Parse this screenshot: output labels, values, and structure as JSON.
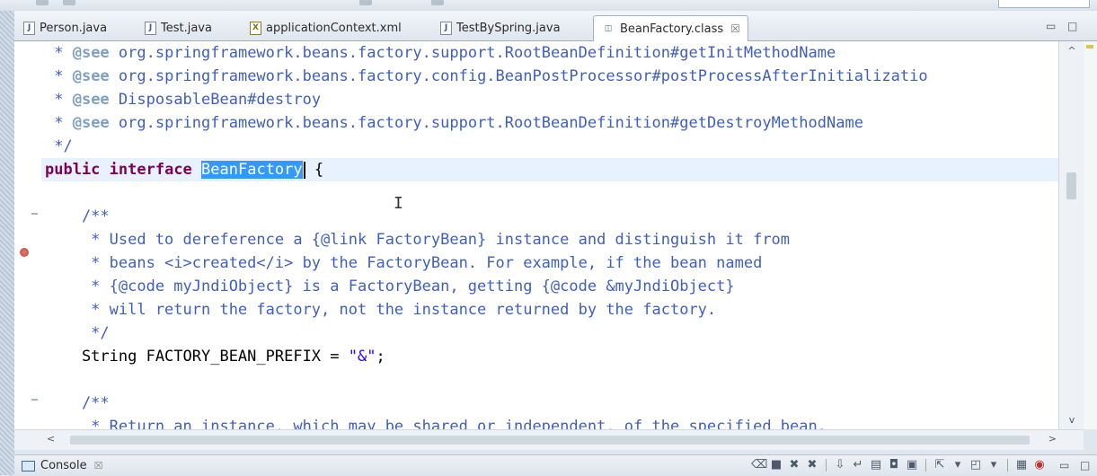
{
  "tabs": [
    {
      "label": "Person.java",
      "icon": "java-file-icon",
      "type": "java"
    },
    {
      "label": "Test.java",
      "icon": "java-file-icon",
      "type": "java"
    },
    {
      "label": "applicationContext.xml",
      "icon": "xml-file-icon",
      "type": "xml"
    },
    {
      "label": "TestBySpring.java",
      "icon": "java-file-icon",
      "type": "java"
    },
    {
      "label": "BeanFactory.class",
      "icon": "class-file-icon",
      "type": "class",
      "active": true
    }
  ],
  "tab_close_glyph": "☒",
  "editor": {
    "lines": {
      "l1a": " * ",
      "l1tag": "@see",
      "l1b": " org.springframework.beans.factory.support.RootBeanDefinition#getInitMethodName",
      "l2a": " * ",
      "l2tag": "@see",
      "l2b": " org.springframework.beans.factory.config.BeanPostProcessor#postProcessAfterInitializatio",
      "l3a": " * ",
      "l3tag": "@see",
      "l3b": " DisposableBean#destroy",
      "l4a": " * ",
      "l4tag": "@see",
      "l4b": " org.springframework.beans.factory.support.RootBeanDefinition#getDestroyMethodName",
      "l5": " */",
      "l6kw1": "public",
      "l6kw2": "interface",
      "l6sel": "BeanFactory",
      "l6rest": " {",
      "l7": "    /**",
      "l8": "     * Used to dereference a {@link FactoryBean} instance and distinguish it from",
      "l9": "     * beans <i>created</i> by the FactoryBean. For example, if the bean named",
      "l10": "     * {@code myJndiObject} is a FactoryBean, getting {@code &myJndiObject}",
      "l11": "     * will return the factory, not the instance returned by the factory.",
      "l12": "     */",
      "l13a": "    String FACTORY_BEAN_PREFIX = ",
      "l13str": "\"&\"",
      "l13b": ";",
      "l14": "    /**",
      "l15": "     * Return an instance, which may be shared or independent, of the specified bean."
    }
  },
  "console": {
    "label": "Console",
    "close_glyph": "☒"
  },
  "colors": {
    "keyword": "#7f0055",
    "comment": "#3f7f5f",
    "javadoc": "#3f5fbf",
    "selection": "#3399ff",
    "string": "#2a00ff"
  }
}
